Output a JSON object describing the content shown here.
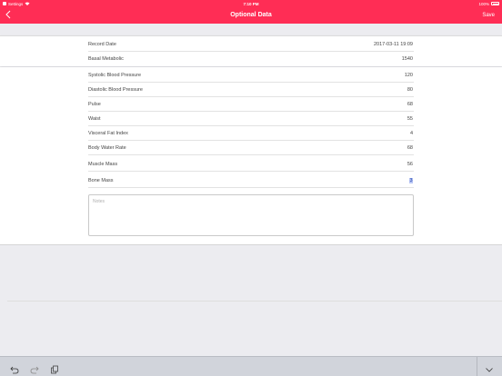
{
  "status_bar": {
    "carrier": "Settings",
    "time": "7:10 PM",
    "battery": "100%"
  },
  "nav": {
    "title": "Optional Data",
    "save_label": "Save",
    "back_icon": "chevron-left-icon"
  },
  "record": {
    "rows": [
      {
        "label": "Record Date",
        "value": "2017-03-11 19:09"
      },
      {
        "label": "Basal Metabolic",
        "value": "1540"
      }
    ]
  },
  "measurements": {
    "rows": [
      {
        "label": "Systolic Blood Pressure",
        "value": "120"
      },
      {
        "label": "Diastolic Blood Pressure",
        "value": "80"
      },
      {
        "label": "Pulse",
        "value": "68"
      },
      {
        "label": "Waist",
        "value": "55"
      },
      {
        "label": "Visceral Fat Index",
        "value": "4"
      },
      {
        "label": "Body Water Rate",
        "value": "68"
      },
      {
        "label": "Muscle Mass",
        "value": "56"
      },
      {
        "label": "Bone Mass",
        "value": "3"
      }
    ]
  },
  "notes": {
    "placeholder": "Notes"
  },
  "colors": {
    "accent": "#ff2d55",
    "toolbar": "#d1d4db"
  },
  "toolbar": {
    "icons": [
      "undo-icon",
      "redo-icon",
      "paste-icon",
      "keyboard-dismiss-icon"
    ]
  }
}
